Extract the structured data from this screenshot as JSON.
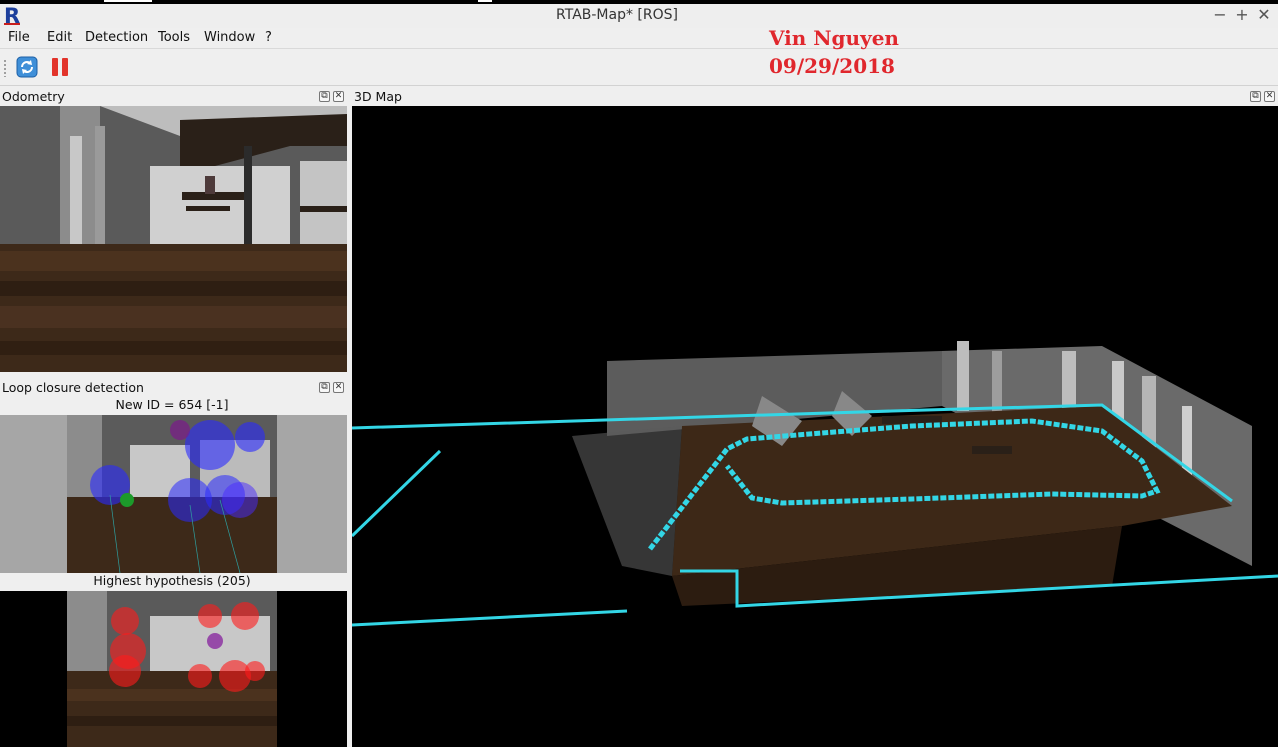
{
  "window": {
    "title": "RTAB-Map* [ROS]",
    "logo_letter": "R",
    "minimize_glyph": "−",
    "maximize_glyph": "+",
    "close_glyph": "✕"
  },
  "menu": [
    "File",
    "Edit",
    "Detection",
    "Tools",
    "Window",
    "?"
  ],
  "watermark": {
    "name": "Vin Nguyen",
    "date": "09/29/2018"
  },
  "toolbar": {
    "refresh_icon": "refresh-icon",
    "pause_icon": "pause-icon"
  },
  "panels": {
    "odometry": {
      "title": "Odometry"
    },
    "loop_closure": {
      "title": "Loop closure detection",
      "new_id": "New ID = 654 [-1]",
      "highest_hypothesis": "Highest hypothesis (205)"
    },
    "map3d": {
      "title": "3D Map"
    }
  },
  "dock_buttons": {
    "float_glyph": "⧉",
    "close_glyph": "✕"
  },
  "colors": {
    "trajectory": "#33d6e6",
    "watermark": "#e0272d",
    "logo": "#1d3f9c",
    "features_blue": "#2a2aff",
    "features_red": "#ff1a1a"
  }
}
